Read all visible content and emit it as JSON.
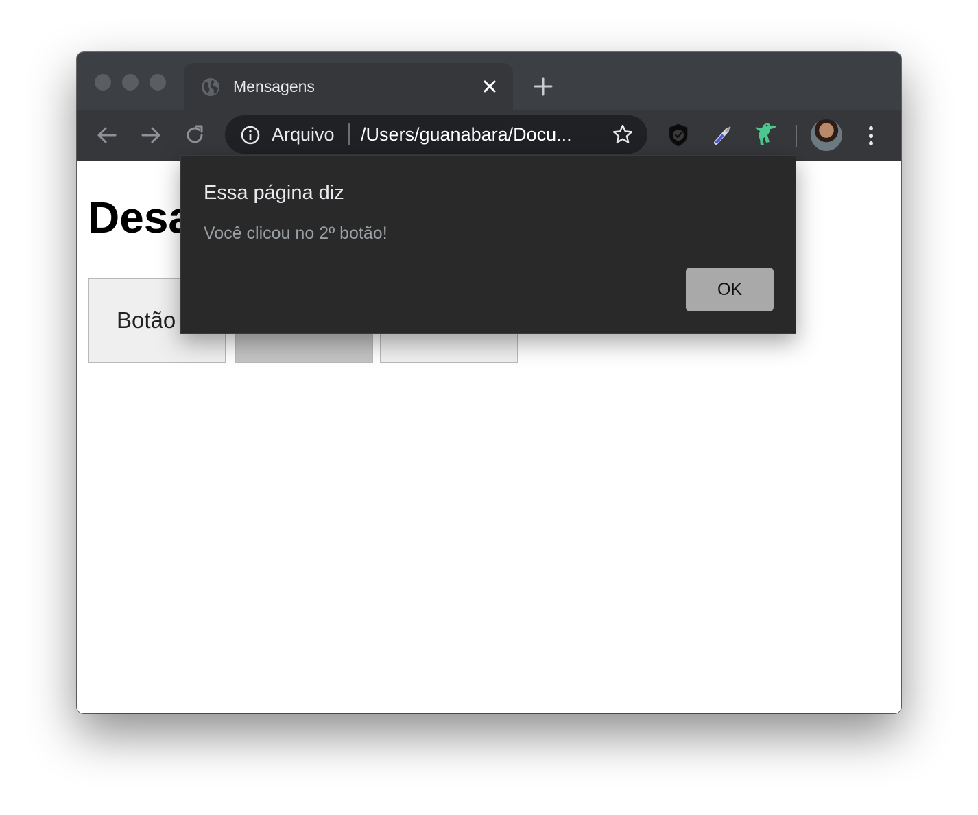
{
  "browser": {
    "tab": {
      "title": "Mensagens",
      "favicon_icon": "globe-icon",
      "close_icon": "close-icon"
    },
    "new_tab_icon": "plus-icon",
    "nav": {
      "back_icon": "arrow-left-icon",
      "forward_icon": "arrow-right-icon",
      "reload_icon": "reload-icon"
    },
    "omnibox": {
      "info_icon": "info-icon",
      "origin_label": "Arquivo",
      "url": "/Users/guanabara/Docu...",
      "bookmark_icon": "star-icon"
    },
    "extensions": [
      "shield-check-icon",
      "eyedropper-icon",
      "green-creature-icon"
    ],
    "profile_icon": "avatar",
    "menu_icon": "kebab-menu-icon"
  },
  "page": {
    "heading": "Desa",
    "buttons": [
      {
        "label": "Botão"
      },
      {
        "label": ""
      },
      {
        "label": ""
      }
    ]
  },
  "alert": {
    "title": "Essa página diz",
    "message": "Você clicou no 2º botão!",
    "ok_label": "OK",
    "ok_bg": "#a9a9a9",
    "bg": "#292929"
  },
  "colors": {
    "tabbar_bg": "#3c3f43",
    "toolbar_bg": "#35373b",
    "omnibox_bg": "#202124",
    "extension_green": "#4cc790"
  }
}
